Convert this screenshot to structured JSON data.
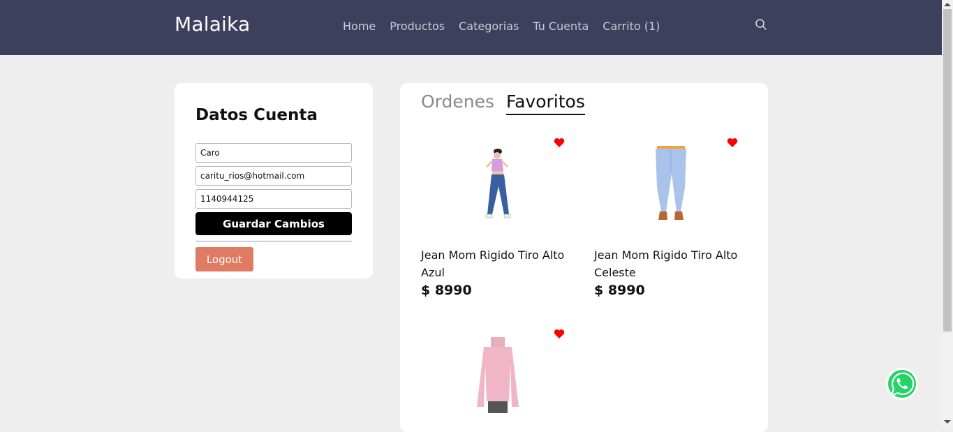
{
  "header": {
    "brand": "Malaika",
    "nav": [
      "Home",
      "Productos",
      "Categorias",
      "Tu Cuenta",
      "Carrito (1)"
    ],
    "icons": {
      "search": "search-icon"
    }
  },
  "account": {
    "title": "Datos Cuenta",
    "name_value": "Caro",
    "email_value": "caritu_rios@hotmail.com",
    "phone_value": "1140944125",
    "save_label": "Guardar Cambios",
    "logout_label": "Logout"
  },
  "tabs": {
    "orders": "Ordenes",
    "favorites": "Favoritos",
    "active": "favorites"
  },
  "favorites": [
    {
      "name": "Jean Mom Rigido Tiro Alto Azul",
      "price": "$ 8990",
      "image": "woman-blue-jeans-photo"
    },
    {
      "name": "Jean Mom Rigido Tiro Alto Celeste",
      "price": "$ 8990",
      "image": "light-blue-jeans-photo"
    },
    {
      "name": "",
      "price": "",
      "image": "pink-sweater-photo"
    }
  ],
  "colors": {
    "header_bg": "#3e3f5c",
    "heart": "#ff0000",
    "save_button": "#000000",
    "logout_button": "#e07b63",
    "whatsapp": "#25d366"
  },
  "floating": {
    "whatsapp_icon": "whatsapp-icon"
  }
}
